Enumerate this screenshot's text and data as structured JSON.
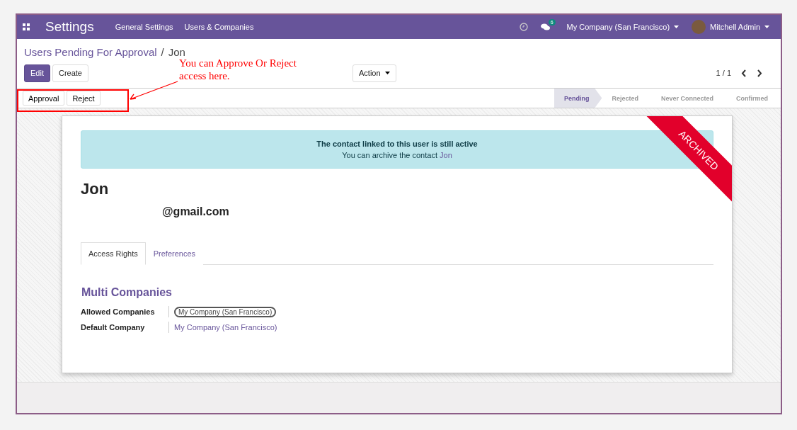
{
  "navbar": {
    "app": "Settings",
    "menu": [
      "General Settings",
      "Users & Companies"
    ],
    "messages_count": "6",
    "company": "My Company (San Francisco)",
    "user": "Mitchell Admin"
  },
  "breadcrumb": {
    "parent": "Users Pending For Approval",
    "separator": "/",
    "current": "Jon"
  },
  "buttons": [
    {
      "label": "Edit",
      "primary": true
    },
    {
      "label": "Create",
      "primary": false
    }
  ],
  "action": "Action",
  "pager": "1 / 1",
  "annotation": "You can Approve Or Reject access here.",
  "status_buttons": [
    "Approval",
    "Reject"
  ],
  "stages": [
    {
      "label": "Pending",
      "selected": true
    },
    {
      "label": "Rejected",
      "selected": false
    },
    {
      "label": "Never Connected",
      "selected": false
    },
    {
      "label": "Confirmed",
      "selected": false
    }
  ],
  "alert": {
    "title": "The contact linked to this user is still active",
    "text": "You can archive the contact",
    "link": "Jon"
  },
  "ribbon": "ARCHIVED",
  "name": "Jon",
  "email": "@gmail.com",
  "tabs": [
    {
      "label": "Access Rights",
      "selected": true
    },
    {
      "label": "Preferences",
      "selected": false
    }
  ],
  "section": "Multi Companies",
  "fields": [
    {
      "label": "Allowed Companies",
      "value": "My Company (San Francisco)",
      "kind": "tag"
    },
    {
      "label": "Default Company",
      "value": "My Company (San Francisco)",
      "kind": "link"
    }
  ]
}
